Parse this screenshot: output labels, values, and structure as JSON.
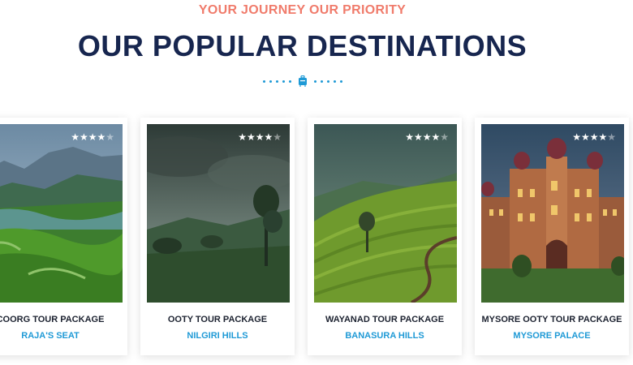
{
  "header": {
    "eyebrow": "YOUR JOURNEY OUR PRIORITY",
    "title": "OUR POPULAR DESTINATIONS",
    "divider_icon": "suitcase-icon"
  },
  "colors": {
    "eyebrow": "#f07b6b",
    "title": "#17264f",
    "accent": "#1f9ad6"
  },
  "cards": [
    {
      "package": "COORG TOUR PACKAGE",
      "place": "RAJA'S SEAT",
      "rating": 4,
      "rating_max": 5
    },
    {
      "package": "OOTY TOUR PACKAGE",
      "place": "NILGIRI HILLS",
      "rating": 4,
      "rating_max": 5
    },
    {
      "package": "WAYANAD TOUR PACKAGE",
      "place": "BANASURA HILLS",
      "rating": 4,
      "rating_max": 5
    },
    {
      "package": "MYSORE OOTY TOUR PACKAGE",
      "place": "MYSORE PALACE",
      "rating": 4,
      "rating_max": 5
    }
  ]
}
